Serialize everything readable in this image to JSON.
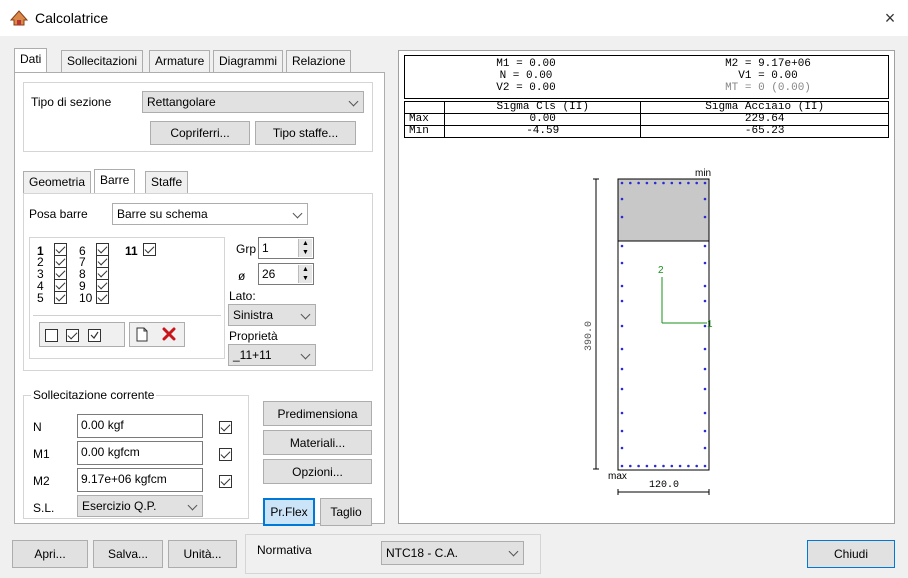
{
  "window": {
    "title": "Calcolatrice",
    "close_glyph": "×"
  },
  "main_tabs": [
    {
      "label": "Dati",
      "active": true
    },
    {
      "label": "Sollecitazioni",
      "active": false
    },
    {
      "label": "Armature",
      "active": false
    },
    {
      "label": "Diagrammi",
      "active": false
    },
    {
      "label": "Relazione",
      "active": false
    }
  ],
  "section": {
    "type_label": "Tipo di sezione",
    "type_value": "Rettangolare",
    "copriferri_button": "Copriferri...",
    "tipo_staffe_button": "Tipo staffe..."
  },
  "sub_tabs": [
    {
      "label": "Geometria",
      "active": false
    },
    {
      "label": "Barre",
      "active": true
    },
    {
      "label": "Staffe",
      "active": false
    }
  ],
  "barre": {
    "posa_label": "Posa barre",
    "posa_value": "Barre su schema",
    "bars": [
      {
        "num": "1",
        "checked": true,
        "bold": true
      },
      {
        "num": "2",
        "checked": true,
        "bold": false
      },
      {
        "num": "3",
        "checked": true,
        "bold": false
      },
      {
        "num": "4",
        "checked": true,
        "bold": false
      },
      {
        "num": "5",
        "checked": true,
        "bold": false
      },
      {
        "num": "6",
        "checked": true,
        "bold": false
      },
      {
        "num": "7",
        "checked": true,
        "bold": false
      },
      {
        "num": "8",
        "checked": true,
        "bold": false
      },
      {
        "num": "9",
        "checked": true,
        "bold": false
      },
      {
        "num": "10",
        "checked": true,
        "bold": false
      },
      {
        "num": "11",
        "checked": true,
        "bold": true
      }
    ],
    "grp_label": "Grp",
    "grp_value": "1",
    "diam_label": "ø",
    "diam_value": "26",
    "lato_label": "Lato:",
    "lato_value": "Sinistra",
    "proprieta_label": "Proprietà",
    "proprieta_value": "_11+11"
  },
  "sollecitazione": {
    "title": "Sollecitazione corrente",
    "rows": [
      {
        "label": "N",
        "value": "0.00 kgf",
        "checked": true
      },
      {
        "label": "M1",
        "value": "0.00 kgfcm",
        "checked": true
      },
      {
        "label": "M2",
        "value": "9.17e+06 kgfcm",
        "checked": true
      }
    ],
    "sl_label": "S.L.",
    "sl_value": "Esercizio Q.P."
  },
  "actions": {
    "predimensiona": "Predimensiona",
    "materiali": "Materiali...",
    "opzioni": "Opzioni...",
    "prflex": "Pr.Flex",
    "taglio": "Taglio"
  },
  "results": {
    "m1": "M1 = 0.00",
    "n": "N = 0.00",
    "v2": "V2 = 0.00",
    "m2": "M2 = 9.17e+06",
    "v1": "V1 = 0.00",
    "mt": "MT = 0 (0.00)",
    "col_cls": "Sigma Cls (II)",
    "col_acciaio": "Sigma Acciaio (II)",
    "max_label": "Max",
    "min_label": "Min",
    "max_cls": "0.00",
    "max_acciaio": "229.64",
    "min_cls": "-4.59",
    "min_acciaio": "-65.23"
  },
  "drawing": {
    "height_dim": "390.0",
    "width_dim": "120.0",
    "label_min": "min",
    "label_max": "max",
    "axis_1": "1",
    "axis_2": "2",
    "axis_color": "#1a8f1a",
    "bar_color": "#2b2bd6",
    "compressed_fill": "#c8c8c8"
  },
  "footer": {
    "apri": "Apri...",
    "salva": "Salva...",
    "unita": "Unità...",
    "normativa_label": "Normativa",
    "normativa_value": "NTC18 - C.A.",
    "chiudi": "Chiudi"
  }
}
